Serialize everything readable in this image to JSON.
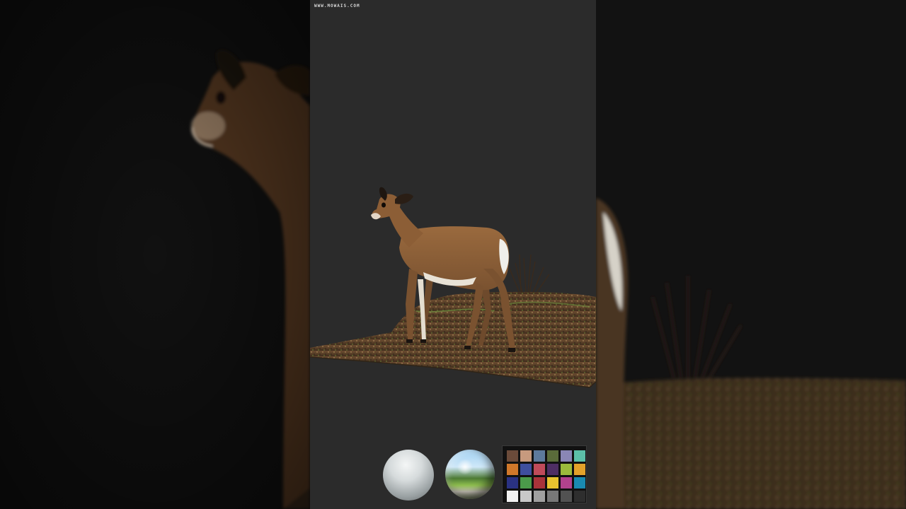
{
  "viewport": {
    "watermark": "WWW.MOWAIS.COM",
    "background": "#2b2b2b"
  },
  "lookdev": {
    "diffuse_ball": "diffuse-sphere",
    "chrome_ball": "chrome-sphere",
    "checker_label": "",
    "color_patches": [
      "#6b4b3a",
      "#c79a7e",
      "#5d7a9c",
      "#5a6b3a",
      "#8a86b5",
      "#5cbfa8",
      "#d0782a",
      "#3f4f9e",
      "#c04b5a",
      "#4e2e63",
      "#9bbb3c",
      "#e3a22a",
      "#2a3283",
      "#4b9a4a",
      "#a9333a",
      "#e8c32f",
      "#b2428d",
      "#1a8ab0",
      "#f2f2f2",
      "#c8c8c8",
      "#a0a0a0",
      "#787878",
      "#525252",
      "#2e2e2e"
    ]
  }
}
